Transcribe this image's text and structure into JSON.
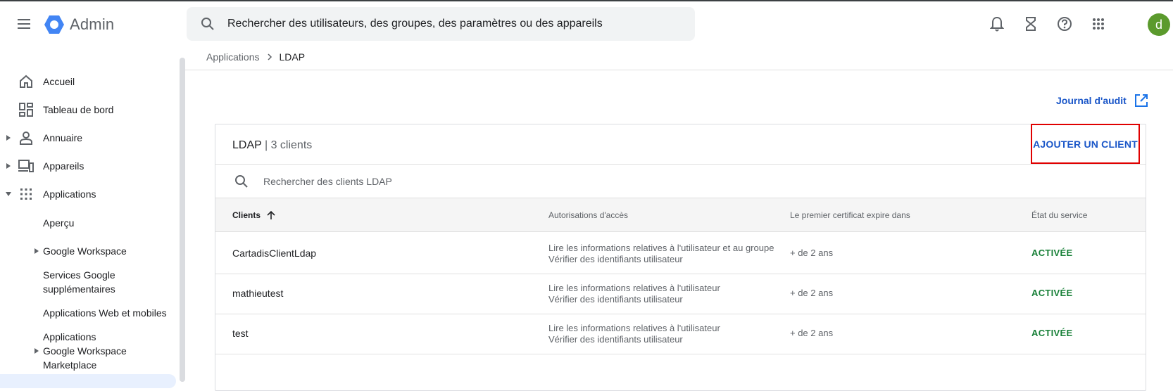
{
  "header": {
    "app_name": "Admin",
    "search_placeholder": "Rechercher des utilisateurs, des groupes, des paramètres ou des appareils",
    "avatar_letter": "d",
    "avatar_color": "#5b9a2d"
  },
  "sidebar": {
    "items": [
      {
        "label": "Accueil",
        "icon": "home-icon"
      },
      {
        "label": "Tableau de bord",
        "icon": "dashboard-icon"
      },
      {
        "label": "Annuaire",
        "icon": "person-icon"
      },
      {
        "label": "Appareils",
        "icon": "devices-icon"
      },
      {
        "label": "Applications",
        "icon": "apps-grid-icon"
      }
    ],
    "subitems": {
      "apercu": "Aperçu",
      "workspace": "Google Workspace",
      "services_l1": "Services Google",
      "services_l2": "supplémentaires",
      "web_mobile": "Applications Web et mobiles",
      "market_l1": "Applications",
      "market_l2": "Google Workspace",
      "market_l3": "Marketplace"
    }
  },
  "breadcrumb": {
    "parent": "Applications",
    "current": "LDAP"
  },
  "audit_link": "Journal d'audit",
  "card": {
    "title": "LDAP",
    "count": "| 3 clients",
    "add_button": "AJOUTER UN CLIENT",
    "search_placeholder": "Rechercher des clients LDAP",
    "columns": [
      "Clients",
      "Autorisations d'accès",
      "Le premier certificat expire dans",
      "État du service"
    ],
    "rows": [
      {
        "name": "CartadisClientLdap",
        "perm1": "Lire les informations relatives à l'utilisateur et au groupe",
        "perm2": "Vérifier des identifiants utilisateur",
        "cert": "+ de 2 ans",
        "state": "ACTIVÉE"
      },
      {
        "name": "mathieutest",
        "perm1": "Lire les informations relatives à l'utilisateur",
        "perm2": "Vérifier des identifiants utilisateur",
        "cert": "+ de 2 ans",
        "state": "ACTIVÉE"
      },
      {
        "name": "test",
        "perm1": "Lire les informations relatives à l'utilisateur",
        "perm2": "Vérifier des identifiants utilisateur",
        "cert": "+ de 2 ans",
        "state": "ACTIVÉE"
      }
    ]
  },
  "colors": {
    "accent": "#1a73e8",
    "status_active": "#188038",
    "highlight_box": "#e00000"
  }
}
